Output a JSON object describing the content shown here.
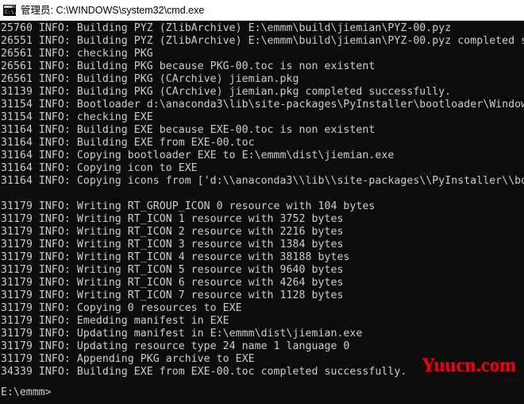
{
  "window": {
    "title": "管理员: C:\\WINDOWS\\system32\\cmd.exe",
    "icon": "cmd-console-icon",
    "background_color": "#0c0c0c",
    "foreground_color": "#cccccc",
    "titlebar_background": "#ffffff",
    "titlebar_foreground": "#000000"
  },
  "console": {
    "lines": [
      "25760 INFO: Building PYZ (ZlibArchive) E:\\emmm\\build\\jiemian\\PYZ-00.pyz",
      "26551 INFO: Building PYZ (ZlibArchive) E:\\emmm\\build\\jiemian\\PYZ-00.pyz completed s",
      "26561 INFO: checking PKG",
      "26561 INFO: Building PKG because PKG-00.toc is non existent",
      "26561 INFO: Building PKG (CArchive) jiemian.pkg",
      "31139 INFO: Building PKG (CArchive) jiemian.pkg completed successfully.",
      "31154 INFO: Bootloader d:\\anaconda3\\lib\\site-packages\\PyInstaller\\bootloader\\Window",
      "31154 INFO: checking EXE",
      "31164 INFO: Building EXE because EXE-00.toc is non existent",
      "31164 INFO: Building EXE from EXE-00.toc",
      "31164 INFO: Copying bootloader EXE to E:\\emmm\\dist\\jiemian.exe",
      "31164 INFO: Copying icon to EXE",
      "31164 INFO: Copying icons from ['d:\\\\anaconda3\\\\lib\\\\site-packages\\\\PyInstaller\\\\bo",
      "",
      "31179 INFO: Writing RT_GROUP_ICON 0 resource with 104 bytes",
      "31179 INFO: Writing RT_ICON 1 resource with 3752 bytes",
      "31179 INFO: Writing RT_ICON 2 resource with 2216 bytes",
      "31179 INFO: Writing RT_ICON 3 resource with 1384 bytes",
      "31179 INFO: Writing RT_ICON 4 resource with 38188 bytes",
      "31179 INFO: Writing RT_ICON 5 resource with 9640 bytes",
      "31179 INFO: Writing RT_ICON 6 resource with 4264 bytes",
      "31179 INFO: Writing RT_ICON 7 resource with 1128 bytes",
      "31179 INFO: Copying 0 resources to EXE",
      "31179 INFO: Emedding manifest in EXE",
      "31179 INFO: Updating manifest in E:\\emmm\\dist\\jiemian.exe",
      "31179 INFO: Updating resource type 24 name 1 language 0",
      "31179 INFO: Appending PKG archive to EXE",
      "34339 INFO: Building EXE from EXE-00.toc completed successfully.",
      "",
      ""
    ],
    "prompt": "E:\\emmm>"
  },
  "watermark": {
    "text": "Yuucn.com",
    "color": "#e60012"
  }
}
